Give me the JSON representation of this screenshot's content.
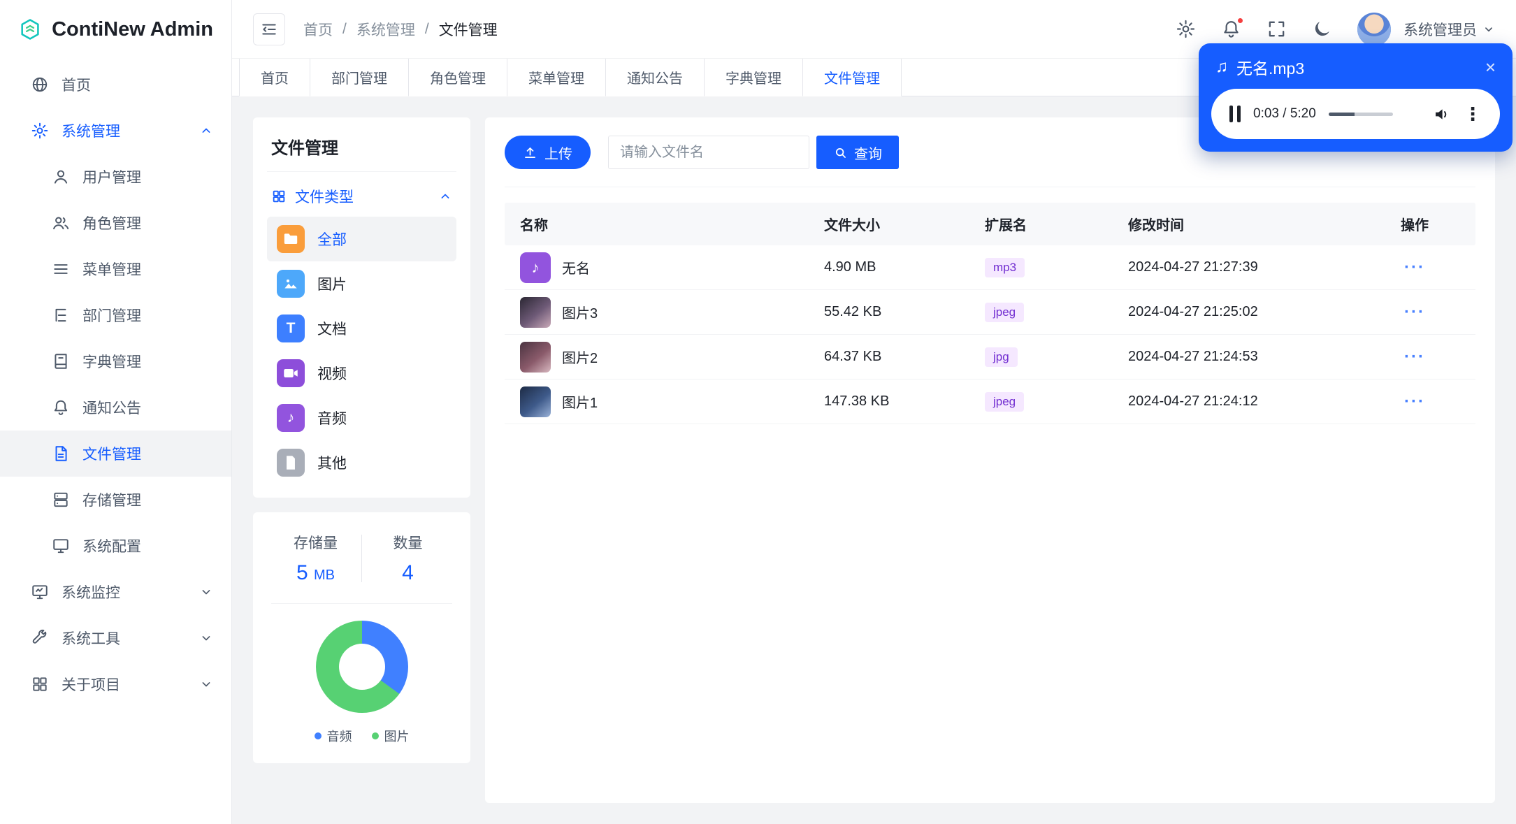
{
  "app": {
    "name": "ContiNew Admin"
  },
  "icons": {
    "music_note": "♪",
    "music_note_double": "♫",
    "close": "×",
    "kebab": "⋮"
  },
  "sidebar": {
    "logo_text": "ContiNew Admin",
    "home": {
      "label": "首页"
    },
    "system": {
      "label": "系统管理"
    },
    "system_children": [
      {
        "label": "用户管理"
      },
      {
        "label": "角色管理"
      },
      {
        "label": "菜单管理"
      },
      {
        "label": "部门管理"
      },
      {
        "label": "字典管理"
      },
      {
        "label": "通知公告"
      },
      {
        "label": "文件管理"
      },
      {
        "label": "存储管理"
      },
      {
        "label": "系统配置"
      }
    ],
    "monitor": {
      "label": "系统监控"
    },
    "tools": {
      "label": "系统工具"
    },
    "about": {
      "label": "关于项目"
    }
  },
  "header": {
    "breadcrumb": {
      "items": [
        "首页",
        "系统管理",
        "文件管理"
      ],
      "separator": "/"
    },
    "user_name": "系统管理员"
  },
  "tabs": [
    "首页",
    "部门管理",
    "角色管理",
    "菜单管理",
    "通知公告",
    "字典管理",
    "文件管理"
  ],
  "active_tab": "文件管理",
  "player": {
    "title": "无名.mp3",
    "time": "0:03 / 5:20",
    "progress_percent": 40
  },
  "file_panel": {
    "title": "文件管理",
    "group_label": "文件类型",
    "types": [
      {
        "label": "全部",
        "icon": "folder-icon",
        "color": "#FA9D3B",
        "selected": true
      },
      {
        "label": "图片",
        "icon": "image-icon",
        "color": "#4DA8FA"
      },
      {
        "label": "文档",
        "icon": "document-icon",
        "color": "#3D7FFF",
        "glyph": "T"
      },
      {
        "label": "视频",
        "icon": "video-icon",
        "color": "#8D4EDA"
      },
      {
        "label": "音频",
        "icon": "audio-icon",
        "color": "#9254DE",
        "glyph": "♪"
      },
      {
        "label": "其他",
        "icon": "file-icon",
        "color": "#A9AEB8"
      }
    ]
  },
  "stats": {
    "storage_label": "存储量",
    "storage_value": "5",
    "storage_unit": "MB",
    "count_label": "数量",
    "count_value": "4",
    "chart_data": {
      "type": "pie",
      "donut": true,
      "labels": [
        "音频",
        "图片"
      ],
      "values": [
        1,
        3
      ],
      "render_fractions": [
        0.35,
        0.65
      ],
      "colors": [
        "#4080FF",
        "#57D173"
      ],
      "legend_position": "bottom"
    }
  },
  "toolbar": {
    "upload_label": "上传",
    "search_placeholder": "请输入文件名",
    "query_label": "查询"
  },
  "table": {
    "columns": [
      "名称",
      "文件大小",
      "扩展名",
      "修改时间",
      "操作"
    ],
    "rows": [
      {
        "name": "无名",
        "size": "4.90 MB",
        "ext": "mp3",
        "time": "2024-04-27 21:27:39",
        "type": "audio"
      },
      {
        "name": "图片3",
        "size": "55.42 KB",
        "ext": "jpeg",
        "time": "2024-04-27 21:25:02",
        "type": "image"
      },
      {
        "name": "图片2",
        "size": "64.37 KB",
        "ext": "jpg",
        "time": "2024-04-27 21:24:53",
        "type": "image"
      },
      {
        "name": "图片1",
        "size": "147.38 KB",
        "ext": "jpeg",
        "time": "2024-04-27 21:24:12",
        "type": "image"
      }
    ],
    "more_glyph": "···"
  },
  "colors": {
    "primary": "#165DFF",
    "badge_bg": "#F5E8FF",
    "badge_text": "#722ED1",
    "notification_dot": "#F53F3F"
  }
}
